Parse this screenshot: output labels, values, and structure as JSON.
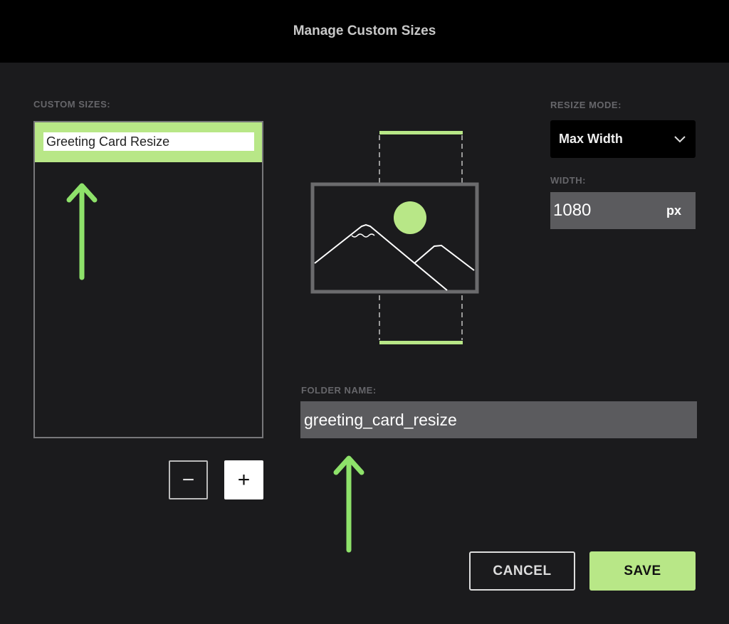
{
  "header": {
    "title": "Manage Custom Sizes"
  },
  "custom_sizes": {
    "label": "CUSTOM SIZES:",
    "items": [
      {
        "name": "Greeting Card Resize",
        "selected": true
      }
    ],
    "remove_label": "−",
    "add_label": "+"
  },
  "resize_mode": {
    "label": "RESIZE MODE:",
    "value": "Max Width"
  },
  "width": {
    "label": "WIDTH:",
    "value": "1080",
    "unit": "px"
  },
  "folder": {
    "label": "FOLDER NAME:",
    "value": "greeting_card_resize"
  },
  "actions": {
    "cancel": "CANCEL",
    "save": "SAVE"
  },
  "colors": {
    "accent": "#b8e787",
    "background": "#1b1b1d",
    "annotation": "#8ee26a"
  }
}
